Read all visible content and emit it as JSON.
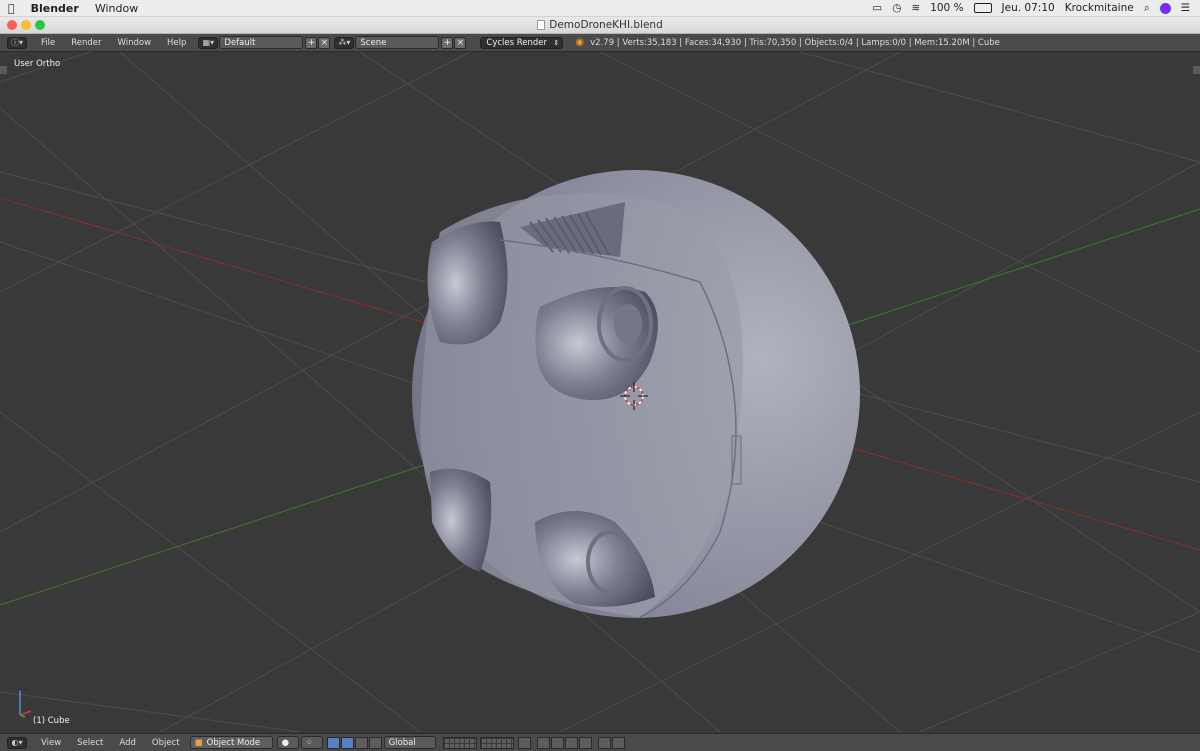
{
  "macos": {
    "app_name": "Blender",
    "menu_window": "Window",
    "battery": "100 %",
    "clock": "Jeu. 07:10",
    "user": "Krockmitaine"
  },
  "window": {
    "title": "DemoDroneKHI.blend"
  },
  "info_header": {
    "menus": [
      "File",
      "Render",
      "Window",
      "Help"
    ],
    "screen_layout": "Default",
    "scene": "Scene",
    "render_engine": "Cycles Render",
    "stats": "v2.79 | Verts:35,183 | Faces:34,930 | Tris:70,350 | Objects:0/4 | Lamps:0/0 | Mem:15.20M | Cube"
  },
  "viewport": {
    "view_name": "User Ortho",
    "active_object": "(1) Cube"
  },
  "footer": {
    "menus": [
      "View",
      "Select",
      "Add",
      "Object"
    ],
    "mode": "Object Mode",
    "orientation": "Global"
  },
  "colors": {
    "viewport_bg": "#393939",
    "x_axis": "#8b2d2d",
    "y_axis": "#3d7a2a",
    "mesh": "#8f90a0"
  }
}
